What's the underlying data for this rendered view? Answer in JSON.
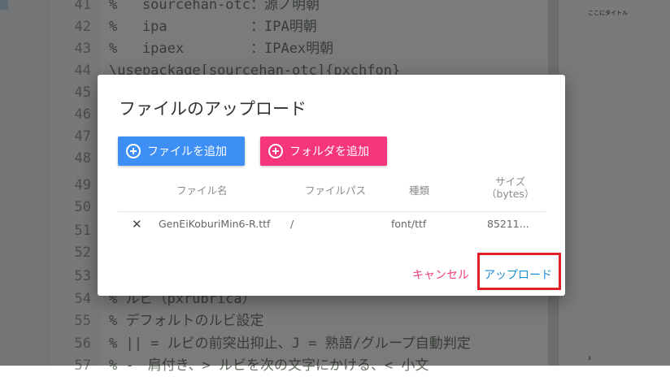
{
  "editor": {
    "lines": [
      {
        "num": "41",
        "text": "%   sourcehan-otc：源ノ明朝"
      },
      {
        "num": "42",
        "text": "%   ipa          ：IPA明朝"
      },
      {
        "num": "43",
        "text": "%   ipaex        ：IPAex明朝"
      },
      {
        "num": "44",
        "text": "\\usepackage[sourcehan-otc]{pxchfon}"
      },
      {
        "num": "45",
        "text": ""
      },
      {
        "num": "46",
        "text": ""
      },
      {
        "num": "47",
        "text": ""
      },
      {
        "num": "48",
        "text": ""
      },
      {
        "num": "49",
        "text": ""
      },
      {
        "num": "50",
        "text": ""
      },
      {
        "num": "51",
        "text": ""
      },
      {
        "num": "52",
        "text": ""
      },
      {
        "num": "53",
        "text": ""
      },
      {
        "num": "54",
        "text": "% ルビ（pxrubrica）"
      },
      {
        "num": "55",
        "text": "% デフォルトのルビ設定"
      },
      {
        "num": "56",
        "text": "% || = ルビの前突出抑止、J = 熟語/グループ自動判定"
      },
      {
        "num": "57",
        "text": "% -　肩付き、> ルビを次の文字にかける、< 小文"
      }
    ]
  },
  "preview": {
    "title": "ここにタイトル",
    "page_number": "3"
  },
  "dialog": {
    "title": "ファイルのアップロード",
    "add_file_label": "ファイルを追加",
    "add_folder_label": "フォルダを追加",
    "columns": {
      "name": "ファイル名",
      "path": "ファイルパス",
      "type": "種類",
      "size": "サイズ",
      "size_unit": "（bytes）"
    },
    "rows": [
      {
        "remove": "✕",
        "name": "GenEiKoburiMin6-R.ttf",
        "path": "/",
        "type": "font/ttf",
        "size": "85211..."
      }
    ],
    "cancel_label": "キャンセル",
    "upload_label": "アップロード"
  }
}
